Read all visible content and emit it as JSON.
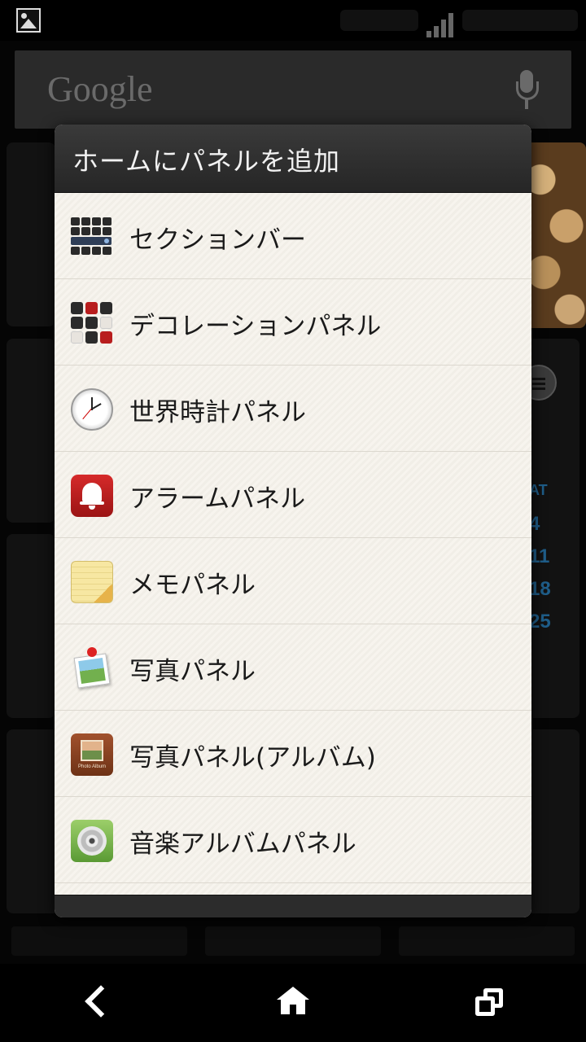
{
  "dialog": {
    "title": "ホームにパネルを追加",
    "items": [
      {
        "label": "セクションバー",
        "icon": "section-bar-icon"
      },
      {
        "label": "デコレーションパネル",
        "icon": "decoration-panel-icon"
      },
      {
        "label": "世界時計パネル",
        "icon": "world-clock-icon"
      },
      {
        "label": "アラームパネル",
        "icon": "alarm-bell-icon"
      },
      {
        "label": "メモパネル",
        "icon": "memo-note-icon"
      },
      {
        "label": "写真パネル",
        "icon": "photo-pin-icon"
      },
      {
        "label": "写真パネル(アルバム)",
        "icon": "photo-album-icon",
        "icon_text": "Photo Album"
      },
      {
        "label": "音楽アルバムパネル",
        "icon": "music-disc-icon"
      }
    ]
  },
  "search_bar": {
    "logo": "Google"
  },
  "background_calendar": {
    "day_header": "AT",
    "dates": [
      "4",
      "11",
      "18",
      "25"
    ]
  },
  "navigation": {
    "back": "back-icon",
    "home": "home-icon",
    "recents": "recents-icon"
  }
}
